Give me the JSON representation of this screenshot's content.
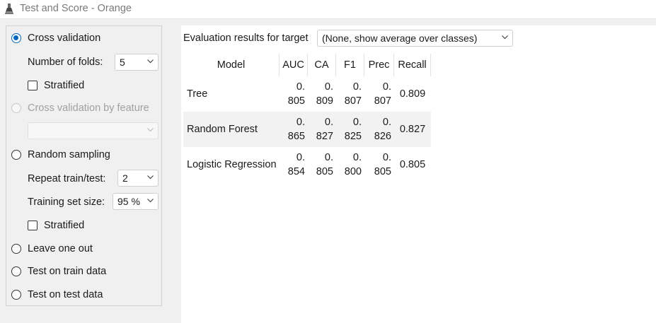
{
  "window": {
    "title": "Test and Score - Orange"
  },
  "sampling": {
    "cross_validation": {
      "label": "Cross validation",
      "selected": true
    },
    "folds": {
      "label": "Number of folds:",
      "value": "5"
    },
    "stratified_cv": {
      "label": "Stratified",
      "checked": false
    },
    "cv_by_feature": {
      "label": "Cross validation by feature",
      "selected": false,
      "enabled": false,
      "value": ""
    },
    "random_sampling": {
      "label": "Random sampling",
      "selected": false
    },
    "repeat": {
      "label": "Repeat train/test:",
      "value": "2"
    },
    "train_size": {
      "label": "Training set size:",
      "value": "95 %"
    },
    "stratified_rs": {
      "label": "Stratified",
      "checked": false
    },
    "leave_one_out": {
      "label": "Leave one out",
      "selected": false
    },
    "test_on_train": {
      "label": "Test on train data",
      "selected": false
    },
    "test_on_test": {
      "label": "Test on test data",
      "selected": false
    }
  },
  "evaluation": {
    "label": "Evaluation results for target",
    "target_value": "(None, show average over classes)"
  },
  "results": {
    "headers": [
      "Model",
      "AUC",
      "CA",
      "F1",
      "Prec",
      "Recall"
    ],
    "rows": [
      {
        "model": "Tree",
        "auc": [
          "0.",
          "805"
        ],
        "ca": [
          "0.",
          "809"
        ],
        "f1": [
          "0.",
          "807"
        ],
        "prec": [
          "0.",
          "807"
        ],
        "recall": "0.809"
      },
      {
        "model": "Random Forest",
        "auc": [
          "0.",
          "865"
        ],
        "ca": [
          "0.",
          "827"
        ],
        "f1": [
          "0.",
          "825"
        ],
        "prec": [
          "0.",
          "826"
        ],
        "recall": "0.827"
      },
      {
        "model": "Logistic Regression",
        "auc": [
          "0.",
          "854"
        ],
        "ca": [
          "0.",
          "805"
        ],
        "f1": [
          "0.",
          "800"
        ],
        "prec": [
          "0.",
          "805"
        ],
        "recall": "0.805"
      }
    ]
  },
  "colors": {
    "accent": "#0067c0",
    "row_alt": "#f2f2f2",
    "disabled_text": "#a0a0a0"
  },
  "icons": {
    "app": "flask-icon",
    "dropdown": "chevron-down-icon"
  }
}
